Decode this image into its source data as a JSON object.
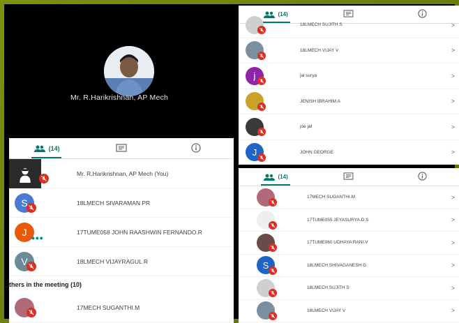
{
  "video": {
    "name": "Mr. R.Harikrishnan, AP Mech"
  },
  "left_panel": {
    "people_count": "(14)",
    "rows": [
      {
        "name": "Mr. R.Harikrishnan, AP Mech (You)",
        "avatar": "photo",
        "color": "#2b2b2b",
        "muted": true
      },
      {
        "name": "18LMECH SIVARAMAN PR",
        "avatar": "S",
        "color": "#4a7bd0",
        "muted": true
      },
      {
        "name": "17TUME058 JOHN RAASHWIN FERNANDO.R",
        "avatar": "J",
        "color": "#e8590c",
        "muted": false,
        "speaking": true
      },
      {
        "name": "18LMECH VIJAYRAGUL R",
        "avatar": "V",
        "color": "#6d8a96",
        "muted": true
      }
    ],
    "section_header": "thers in the meeting (10)",
    "others": [
      {
        "name": "17MECH SUGANTHI.M",
        "avatar": "photo",
        "color": "#b06a7a",
        "muted": true
      }
    ]
  },
  "top_right_panel": {
    "people_count": "(14)",
    "rows": [
      {
        "name": "18LMECH SUJITH S",
        "avatar": "photo",
        "color": "#cfcfcf"
      },
      {
        "name": "18LMECH VIJAY V",
        "avatar": "photo",
        "color": "#7a8fa0"
      },
      {
        "name": "jai surya",
        "avatar": "j",
        "color": "#8e24aa"
      },
      {
        "name": "JENISH IBRAHIM.A",
        "avatar": "photo",
        "color": "#c9a227"
      },
      {
        "name": "joe jaf",
        "avatar": "photo",
        "color": "#3a3a3a"
      },
      {
        "name": "JOHN GEORGE",
        "avatar": "J",
        "color": "#1e63c6"
      }
    ],
    "chevron": ">"
  },
  "bottom_right_panel": {
    "people_count": "(14)",
    "rows": [
      {
        "name": "17MECH SUGANTHI.M",
        "avatar": "photo",
        "color": "#b06a7a"
      },
      {
        "name": "17TUME055 JEYASURYA.D.S",
        "avatar": "photo",
        "color": "#eeeeee"
      },
      {
        "name": "17TUME060 UDHAYA RANI.V",
        "avatar": "photo",
        "color": "#6a4a4a"
      },
      {
        "name": "18LMECH SHIVAGANESH G",
        "avatar": "S",
        "color": "#1e63c6"
      },
      {
        "name": "18LMECH SUJITH S",
        "avatar": "photo",
        "color": "#cfcfcf"
      },
      {
        "name": "18LMECH VIJAY V",
        "avatar": "photo",
        "color": "#7a8fa0"
      }
    ],
    "chevron": ">"
  },
  "icons": {
    "people": "people-icon",
    "chat": "chat-icon",
    "info": "info-icon",
    "mic_off": "mic-off-icon"
  }
}
